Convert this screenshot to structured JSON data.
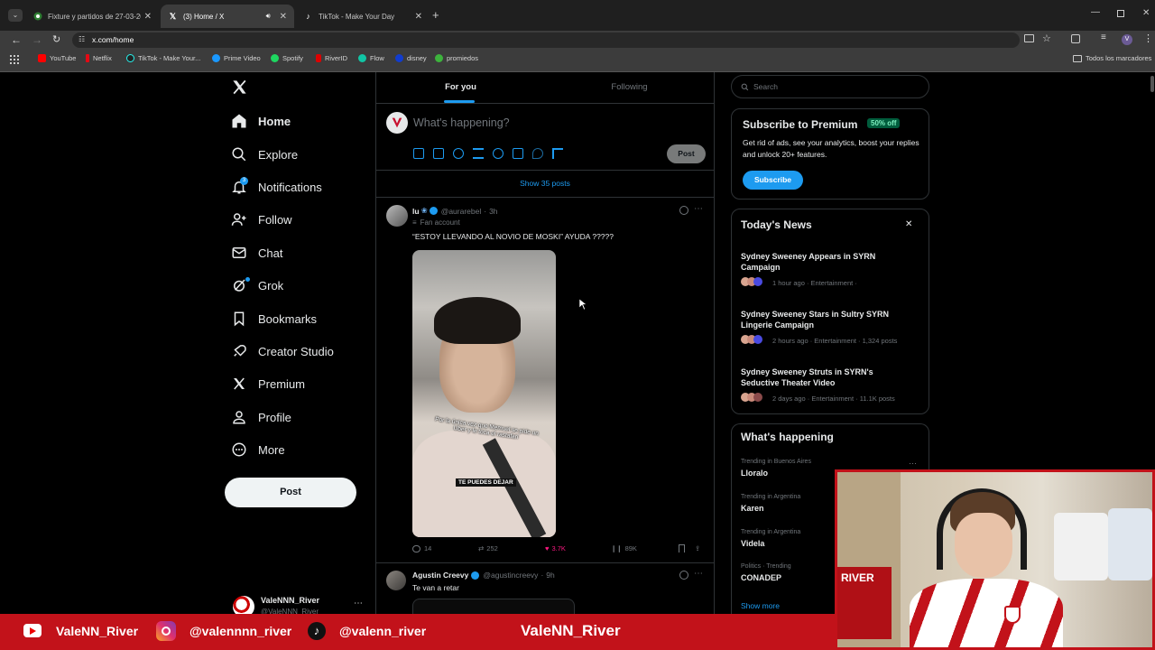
{
  "browser": {
    "tabs": [
      {
        "title": "Fixture y partidos de 27-03-2025",
        "active": false
      },
      {
        "title": "(3) Home / X",
        "active": true
      },
      {
        "title": "TikTok - Make Your Day",
        "active": false
      }
    ],
    "url": "x.com/home",
    "bookmarks": [
      "YouTube",
      "Netflix",
      "TikTok - Make Your...",
      "Prime Video",
      "Spotify",
      "RiverID",
      "Flow",
      "disney",
      "promiedos"
    ],
    "all_bookmarks": "Todos los marcadores"
  },
  "nav": {
    "items": [
      {
        "label": "Home",
        "icon": "home-icon"
      },
      {
        "label": "Explore",
        "icon": "search-icon"
      },
      {
        "label": "Notifications",
        "icon": "bell-icon"
      },
      {
        "label": "Follow",
        "icon": "follow-icon"
      },
      {
        "label": "Chat",
        "icon": "chat-icon"
      },
      {
        "label": "Grok",
        "icon": "grok-icon"
      },
      {
        "label": "Bookmarks",
        "icon": "bookmark-icon"
      },
      {
        "label": "Creator Studio",
        "icon": "rocket-icon"
      },
      {
        "label": "Premium",
        "icon": "x-icon"
      },
      {
        "label": "Profile",
        "icon": "profile-icon"
      },
      {
        "label": "More",
        "icon": "more-icon"
      }
    ],
    "notif_badge": "3",
    "post_button": "Post",
    "account_name": "ValeNNN_River",
    "account_handle": "@ValeNNN_River"
  },
  "feed": {
    "tabs": [
      "For you",
      "Following"
    ],
    "composer_placeholder": "What's happening?",
    "composer_post": "Post",
    "show_posts": "Show 35 posts",
    "post1": {
      "name": "lu",
      "handle": "@aurarebel",
      "time": "3h",
      "label": "Fan account",
      "text": "“ESTOY LLEVANDO AL NOVIO DE MOSKI” AYUDA ?????",
      "video_caption": "Por la única vez que Memuel se pide un Uber y le toca el rastafari",
      "video_subtitle": "TE PUEDES DEJAR",
      "replies": "14",
      "reposts": "252",
      "likes": "3.7K",
      "views": "89K"
    },
    "post2": {
      "name": "Agustin Creevy",
      "handle": "@agustincreevy",
      "time": "9h",
      "text": "Te van a retar"
    }
  },
  "right": {
    "search_placeholder": "Search",
    "premium": {
      "title": "Subscribe to Premium",
      "badge": "50% off",
      "desc": "Get rid of ads, see your analytics, boost your replies and unlock 20+ features.",
      "button": "Subscribe"
    },
    "news": {
      "title": "Today's News",
      "items": [
        {
          "title": "Sydney Sweeney Appears in SYRN Campaign",
          "meta": "1 hour ago · Entertainment ·"
        },
        {
          "title": "Sydney Sweeney Stars in Sultry SYRN Lingerie Campaign",
          "meta": "2 hours ago · Entertainment · 1,324 posts"
        },
        {
          "title": "Sydney Sweeney Struts in SYRN's Seductive Theater Video",
          "meta": "2 days ago · Entertainment · 11.1K posts"
        }
      ]
    },
    "happening": {
      "title": "What's happening",
      "trends": [
        {
          "context": "Trending in Buenos Aires",
          "name": "Lloralo"
        },
        {
          "context": "Trending in Argentina",
          "name": "Karen"
        },
        {
          "context": "Trending in Argentina",
          "name": "Videla"
        },
        {
          "context": "Politics · Trending",
          "name": "CONADEP"
        }
      ],
      "show_more": "Show more"
    }
  },
  "banner": {
    "youtube": "ValeNN_River",
    "instagram": "@valennnn_river",
    "tiktok": "@valenn_river",
    "center": "ValeNN_River"
  },
  "webcam": {
    "shirt_text": "RIVER"
  }
}
